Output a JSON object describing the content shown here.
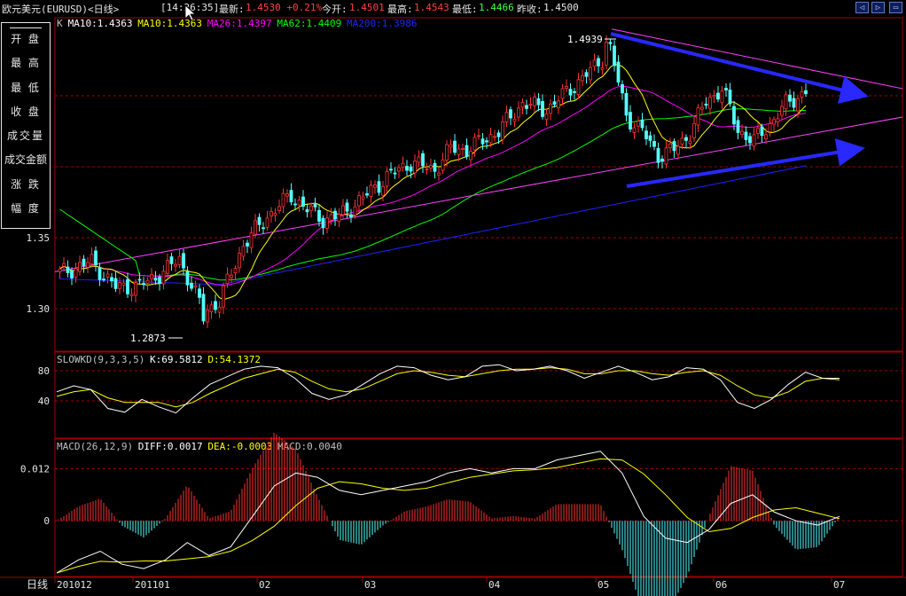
{
  "header": {
    "symbol": "欧元美元(EURUSD)<日线>",
    "time": "[14:26:35]",
    "latest_label": "最新:",
    "latest_value": "1.4530 +0.21%",
    "open_label": "今开:",
    "open_value": "1.4501",
    "high_label": "最高:",
    "high_value": "1.4543",
    "low_label": "最低:",
    "low_value": "1.4466",
    "prev_label": "昨收:",
    "prev_value": "1.4500"
  },
  "window_buttons": [
    "◁",
    "▷",
    "▭"
  ],
  "left_menu": [
    "开 盘",
    "最 高",
    "最 低",
    "收 盘",
    "成交量",
    "成交金额",
    "涨 跌",
    "幅 度"
  ],
  "main_legend": [
    {
      "text": "K",
      "color": "#c0c0c0"
    },
    {
      "text": "MA10:1.4363",
      "color": "#ffffff"
    },
    {
      "text": "MA10:1.4363",
      "color": "#ffff00"
    },
    {
      "text": "MA26:1.4397",
      "color": "#ff00ff"
    },
    {
      "text": "MA62:1.4409",
      "color": "#00ff00"
    },
    {
      "text": "MA200:1.3986",
      "color": "#2424ff"
    }
  ],
  "kd_legend": [
    {
      "text": "SLOWKD(9,3,3,5)",
      "color": "#c0c0c0"
    },
    {
      "text": "K:69.5812",
      "color": "#ffffff"
    },
    {
      "text": "D:54.1372",
      "color": "#ffff00"
    }
  ],
  "macd_legend": [
    {
      "text": "MACD(26,12,9)",
      "color": "#c0c0c0"
    },
    {
      "text": "DIFF:0.0017",
      "color": "#ffffff"
    },
    {
      "text": "DEA:-0.0003",
      "color": "#ffff00"
    },
    {
      "text": "MACD:0.0040",
      "color": "#c0c0c0"
    }
  ],
  "price_axis": [
    "1.35",
    "1.30"
  ],
  "kd_axis": [
    "80",
    "40"
  ],
  "macd_axis": [
    "0.012",
    "0"
  ],
  "high_marker": "1.4939",
  "low_marker": "1.2873",
  "period_label": "日线",
  "date_axis": [
    "201012",
    "201101",
    "02",
    "03",
    "04",
    "05",
    "06",
    "07"
  ],
  "colors": {
    "up": "#ff3232",
    "down": "#54ffff",
    "grid": "#a00000",
    "frame": "#a00000",
    "trendline": "#2828ff",
    "ma10": "#ffff00",
    "ma26": "#ff00ff",
    "ma62": "#00ff00",
    "ma200": "#2020ff",
    "k_line": "#ffffff",
    "d_line": "#ffff00",
    "menu_border": "#e6e6e6"
  },
  "chart_data": {
    "type": "candlestick",
    "price_ticks": [
      1.3,
      1.35
    ],
    "price_range": [
      1.2873,
      1.4939
    ],
    "kd_ticks": [
      40,
      80
    ],
    "macd_ticks": [
      0,
      0.012
    ],
    "macd_range": [
      -0.012,
      0.018
    ],
    "kd_range": [
      0,
      100
    ],
    "period": "daily",
    "bars": 168,
    "trend_start_close": 1.325,
    "series": [
      {
        "name": "MA10",
        "last": 1.4363
      },
      {
        "name": "MA26",
        "last": 1.4397
      },
      {
        "name": "MA62",
        "last": 1.4409
      },
      {
        "name": "MA200",
        "last": 1.3986
      }
    ],
    "anchors": [
      [
        0,
        1.325
      ],
      [
        8,
        1.333
      ],
      [
        14,
        1.315
      ],
      [
        20,
        1.316
      ],
      [
        26,
        1.326
      ],
      [
        30,
        1.335
      ],
      [
        36,
        1.298
      ],
      [
        40,
        1.305
      ],
      [
        46,
        1.345
      ],
      [
        52,
        1.365
      ],
      [
        58,
        1.38
      ],
      [
        62,
        1.37
      ],
      [
        66,
        1.363
      ],
      [
        70,
        1.365
      ],
      [
        76,
        1.378
      ],
      [
        82,
        1.393
      ],
      [
        88,
        1.403
      ],
      [
        94,
        1.398
      ],
      [
        98,
        1.413
      ],
      [
        102,
        1.412
      ],
      [
        110,
        1.425
      ],
      [
        116,
        1.445
      ],
      [
        122,
        1.44
      ],
      [
        128,
        1.455
      ],
      [
        134,
        1.47
      ],
      [
        138,
        1.483
      ],
      [
        142,
        1.436
      ],
      [
        146,
        1.425
      ],
      [
        150,
        1.408
      ],
      [
        154,
        1.412
      ],
      [
        158,
        1.424
      ],
      [
        162,
        1.446
      ],
      [
        166,
        1.455
      ],
      [
        170,
        1.426
      ],
      [
        174,
        1.418
      ],
      [
        178,
        1.43
      ],
      [
        182,
        1.444
      ],
      [
        187,
        1.453
      ]
    ],
    "kd_k": [
      52,
      60,
      55,
      30,
      25,
      42,
      32,
      24,
      44,
      62,
      72,
      82,
      86,
      84,
      70,
      50,
      42,
      48,
      62,
      76,
      86,
      84,
      74,
      68,
      72,
      86,
      88,
      80,
      82,
      86,
      80,
      70,
      78,
      86,
      78,
      68,
      72,
      84,
      82,
      68,
      38,
      30,
      42,
      62,
      78,
      70,
      70
    ],
    "kd_d": [
      46,
      52,
      55,
      44,
      38,
      38,
      38,
      32,
      38,
      50,
      60,
      70,
      76,
      82,
      78,
      66,
      56,
      52,
      56,
      66,
      76,
      80,
      78,
      74,
      72,
      76,
      80,
      82,
      82,
      84,
      82,
      76,
      76,
      80,
      80,
      76,
      74,
      78,
      80,
      74,
      60,
      48,
      44,
      52,
      66,
      70,
      68
    ],
    "macd_diff": [
      -0.012,
      -0.009,
      -0.007,
      -0.01,
      -0.011,
      -0.009,
      -0.005,
      -0.008,
      -0.006,
      0.001,
      0.008,
      0.011,
      0.01,
      0.007,
      0.006,
      0.007,
      0.008,
      0.009,
      0.011,
      0.012,
      0.011,
      0.012,
      0.012,
      0.014,
      0.015,
      0.016,
      0.011,
      0.001,
      -0.004,
      -0.005,
      -0.002,
      0.004,
      0.006,
      0.002,
      0.0,
      -0.001,
      0.001
    ]
  }
}
